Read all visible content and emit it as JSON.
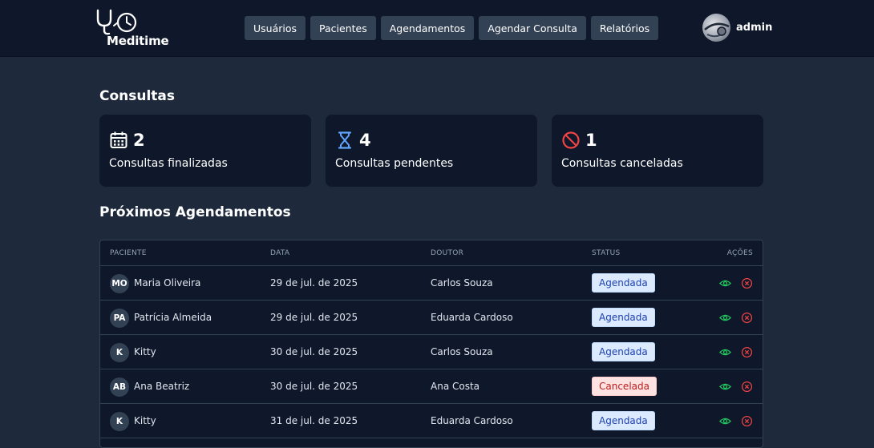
{
  "brand": {
    "name": "Meditime"
  },
  "nav": {
    "items": [
      "Usuários",
      "Pacientes",
      "Agendamentos",
      "Agendar Consulta",
      "Relatórios"
    ]
  },
  "user": {
    "name": "admin"
  },
  "summary": {
    "title": "Consultas",
    "cards": [
      {
        "value": "2",
        "label": "Consultas finalizadas",
        "icon": "calendar-icon",
        "icon_color": "#ffffff"
      },
      {
        "value": "4",
        "label": "Consultas pendentes",
        "icon": "hourglass-icon",
        "icon_color": "#60a5fa"
      },
      {
        "value": "1",
        "label": "Consultas canceladas",
        "icon": "ban-icon",
        "icon_color": "#ef4444"
      }
    ]
  },
  "appointments": {
    "title": "Próximos Agendamentos",
    "columns": [
      "Paciente",
      "Data",
      "Doutor",
      "Status",
      "Ações"
    ],
    "rows": [
      {
        "initials": "MO",
        "patient": "Maria Oliveira",
        "date": "29 de jul. de 2025",
        "doctor": "Carlos Souza",
        "status": "Agendada"
      },
      {
        "initials": "PA",
        "patient": "Patrícia Almeida",
        "date": "29 de jul. de 2025",
        "doctor": "Eduarda Cardoso",
        "status": "Agendada"
      },
      {
        "initials": "K",
        "patient": "Kitty",
        "date": "30 de jul. de 2025",
        "doctor": "Carlos Souza",
        "status": "Agendada"
      },
      {
        "initials": "AB",
        "patient": "Ana Beatriz",
        "date": "30 de jul. de 2025",
        "doctor": "Ana Costa",
        "status": "Cancelada"
      },
      {
        "initials": "K",
        "patient": "Kitty",
        "date": "31 de jul. de 2025",
        "doctor": "Eduarda Cardoso",
        "status": "Agendada"
      }
    ]
  },
  "colors": {
    "background": "#1e293b",
    "topbar": "#0f172a",
    "card": "#0f172a",
    "view_action": "#22c55e",
    "cancel_action": "#ef4444"
  }
}
